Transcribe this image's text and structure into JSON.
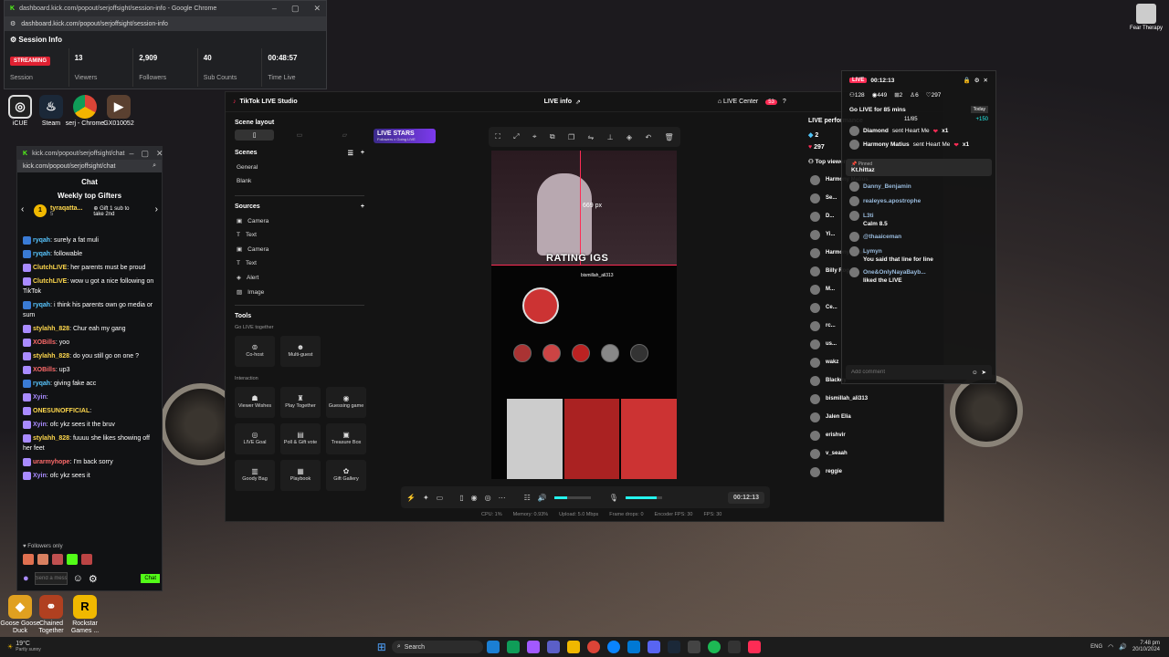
{
  "session_window": {
    "url": "dashboard.kick.com/popout/serjoffsight/session-info - Google Chrome",
    "address": "dashboard.kick.com/popout/serjoffsight/session-info",
    "heading": "Session Info",
    "status_badge": "STREAMING",
    "session_label": "Session",
    "viewers_value": "13",
    "viewers_label": "Viewers",
    "followers_value": "2,909",
    "followers_label": "Followers",
    "subs_value": "40",
    "subs_label": "Sub Counts",
    "time_value": "00:48:57",
    "time_label": "Time Live"
  },
  "desktop_icons": [
    {
      "label": "iCUE",
      "color": "#222"
    },
    {
      "label": "Steam",
      "color": "#1b2838"
    },
    {
      "label": "serj - Chrome",
      "color": "#db4437"
    },
    {
      "label": "GX010052",
      "color": "#5a4030"
    }
  ],
  "left_icons": [
    {
      "label": "Goose Goose Duck",
      "color": "#e0a020"
    },
    {
      "label": "Chained Together",
      "color": "#b04020"
    },
    {
      "label": "Rockstar Games ...",
      "color": "#f0b800"
    }
  ],
  "chat_window": {
    "url": "kick.com/popout/serjoffsight/chat",
    "address": "kick.com/popout/serjoffsight/chat",
    "title": "Chat",
    "gifters_title": "Weekly top Gifters",
    "top_gifter": "tyraqatta...",
    "top_gifter_count": "5",
    "gift_cta": "Gift 1 sub to take 2nd",
    "messages": [
      {
        "user": "ryqah",
        "color": "#58c6ff",
        "text": "surely a fat muli"
      },
      {
        "user": "ryqah",
        "color": "#58c6ff",
        "text": "followable"
      },
      {
        "user": "ClutchLIVE",
        "color": "#ffd84d",
        "text": "her parents must be proud"
      },
      {
        "user": "ClutchLIVE",
        "color": "#ffd84d",
        "text": "wow u got a nice following on TikTok"
      },
      {
        "user": "ryqah",
        "color": "#58c6ff",
        "text": "i think his parents own go media or sum"
      },
      {
        "user": "stylahh_828",
        "color": "#ffd84d",
        "text": "Chur eah my gang"
      },
      {
        "user": "XOBills",
        "color": "#ff6b6b",
        "text": "yoo"
      },
      {
        "user": "stylahh_828",
        "color": "#ffd84d",
        "text": "do you still go on one ?"
      },
      {
        "user": "XOBills",
        "color": "#ff6b6b",
        "text": "up3"
      },
      {
        "user": "ryqah",
        "color": "#58c6ff",
        "text": "giving fake acc"
      },
      {
        "user": "Xyin",
        "color": "#a98bff",
        "text": ""
      },
      {
        "user": "ONESUNOFFICIAL",
        "color": "#ffd84d",
        "text": ""
      },
      {
        "user": "Xyin",
        "color": "#a98bff",
        "text": "ofc ykz sees it the bruv"
      },
      {
        "user": "stylahh_828",
        "color": "#ffd84d",
        "text": "fuuuu she likes showing off her feet"
      },
      {
        "user": "urarmyhope",
        "color": "#ff6b6b",
        "text": "I'm back sorry"
      },
      {
        "user": "Xyin",
        "color": "#a98bff",
        "text": "ofc ykz sees it"
      }
    ],
    "followers_only": "Followers only",
    "placeholder": "Send a message",
    "send_label": "Chat"
  },
  "tiktok": {
    "app_title": "TikTok LIVE Studio",
    "center_title": "LIVE info",
    "live_center": "LIVE Center",
    "notif_count": "53",
    "scene_layout": "Scene layout",
    "scenes_label": "Scenes",
    "scenes": [
      "General",
      "Blank"
    ],
    "sources_label": "Sources",
    "sources": [
      {
        "label": "Camera",
        "icon": "camera-icon"
      },
      {
        "label": "Text",
        "icon": "text-icon"
      },
      {
        "label": "Camera",
        "icon": "camera-icon"
      },
      {
        "label": "Text",
        "icon": "text-icon"
      },
      {
        "label": "Alert",
        "icon": "alert-icon"
      },
      {
        "label": "Image",
        "icon": "image-icon"
      }
    ],
    "tools_label": "Tools",
    "go_live_together": "Go LIVE together",
    "go_live_tools": [
      {
        "label": "Co-host",
        "glyph": "⊚"
      },
      {
        "label": "Multi-guest",
        "glyph": "☻"
      }
    ],
    "interaction_label": "Interaction",
    "interaction_tools": [
      {
        "label": "Viewer Wishes",
        "glyph": "☗"
      },
      {
        "label": "Play Together",
        "glyph": "♜"
      },
      {
        "label": "Guessing game",
        "glyph": "◉"
      },
      {
        "label": "LIVE Goal",
        "glyph": "◎"
      },
      {
        "label": "Poll & Gift vote",
        "glyph": "▤"
      },
      {
        "label": "Treasure Box",
        "glyph": "▣"
      },
      {
        "label": "Goody Bag",
        "glyph": "▥"
      },
      {
        "label": "Playbook",
        "glyph": "▦"
      },
      {
        "label": "Gift Gallery",
        "glyph": "✿"
      }
    ],
    "banner": "LIVE STARS",
    "banner_sub": "Followers x Going LIVE",
    "measure": "669 px",
    "overlay_text": "RATING IGS",
    "profile_name": "bismillah_ali313",
    "timer": "00:12:13",
    "stats": {
      "cpu": "CPU: 1%",
      "memory": "Memory: 0.93%",
      "upload": "Upload: 5.0 Mbps",
      "frame_drops": "Frame drops: 0",
      "encoder": "Encoder FPS: 30",
      "fps": "FPS: 30"
    },
    "perf_label": "LIVE performance",
    "perf_diamonds": "2",
    "perf_viewers": "297",
    "top_viewers": "Top viewers",
    "viewers": [
      "Harmony Matius",
      "Se...",
      "D...",
      "Yi...",
      "Harmony Wilson",
      "Billy Rog...",
      "M...",
      "Ce...",
      "rc...",
      "us...",
      "wakz",
      "Blackey",
      "bismillah_ali313",
      "Jalen Elia",
      "erishvir",
      "v_seaah",
      "reggie"
    ]
  },
  "live_popout": {
    "live_badge": "LIVE",
    "timer": "00:12:13",
    "stat_viewers": "128",
    "stat_views": "449",
    "stat_gifts": "2",
    "stat_users": "6",
    "stat_likes": "297",
    "goal_text": "Go LIVE for 85 mins",
    "goal_progress": "11/85",
    "today": "Today",
    "bonus": "+150",
    "events": [
      {
        "user": "Diamond",
        "text": "sent Heart Me",
        "mult": "x1"
      },
      {
        "user": "Harmony Matius",
        "text": "sent Heart Me",
        "mult": "x1"
      }
    ],
    "pinned_label": "Pinned",
    "pinned_user": "Kt.hittaz",
    "comments": [
      {
        "user": "Danny_Benjamin",
        "text": ""
      },
      {
        "user": "realeyes.apostrophe",
        "text": ""
      },
      {
        "user": "L3ti",
        "text": "Calm 8.5"
      },
      {
        "user": "@thaaiceman",
        "text": ""
      },
      {
        "user": "Lymyn",
        "text": "You said that line for line"
      },
      {
        "user": "One&OnlyNayaBayb...",
        "text": "liked the LIVE"
      }
    ],
    "add_comment": "Add comment"
  },
  "corner_profile": {
    "label": "Fear Therapy"
  },
  "taskbar": {
    "weather_temp": "19°C",
    "weather_desc": "Partly sunny",
    "search": "Search",
    "lang": "ENG",
    "time": "7:48 pm",
    "date": "20/10/2024"
  }
}
